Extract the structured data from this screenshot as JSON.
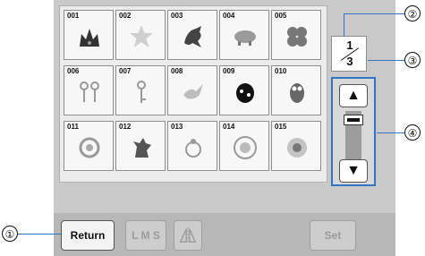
{
  "pattern_grid": {
    "tiles": [
      {
        "number": "001",
        "icon": "crown-icon"
      },
      {
        "number": "002",
        "icon": "star-icon"
      },
      {
        "number": "003",
        "icon": "dragon-icon"
      },
      {
        "number": "004",
        "icon": "pig-icon"
      },
      {
        "number": "005",
        "icon": "clover-icon"
      },
      {
        "number": "006",
        "icon": "keys-pair-icon"
      },
      {
        "number": "007",
        "icon": "key-icon"
      },
      {
        "number": "008",
        "icon": "dove-icon"
      },
      {
        "number": "009",
        "icon": "ladybug-icon"
      },
      {
        "number": "010",
        "icon": "owl-icon"
      },
      {
        "number": "011",
        "icon": "ornament-icon"
      },
      {
        "number": "012",
        "icon": "lion-crest-icon"
      },
      {
        "number": "013",
        "icon": "ornament-small-icon"
      },
      {
        "number": "014",
        "icon": "floral-medallion-icon"
      },
      {
        "number": "015",
        "icon": "flower-icon"
      }
    ]
  },
  "pager": {
    "current": "1",
    "total": "3"
  },
  "scroll": {
    "up_symbol": "▲",
    "down_symbol": "▼"
  },
  "buttons": {
    "return": "Return",
    "size": "L M S",
    "mirror_icon": "mirror-icon",
    "set": "Set"
  },
  "callouts": {
    "c1": "①",
    "c2": "②",
    "c3": "③",
    "c4": "④"
  },
  "colors": {
    "accent": "#2e75c3",
    "panel": "#c9c9c9"
  }
}
